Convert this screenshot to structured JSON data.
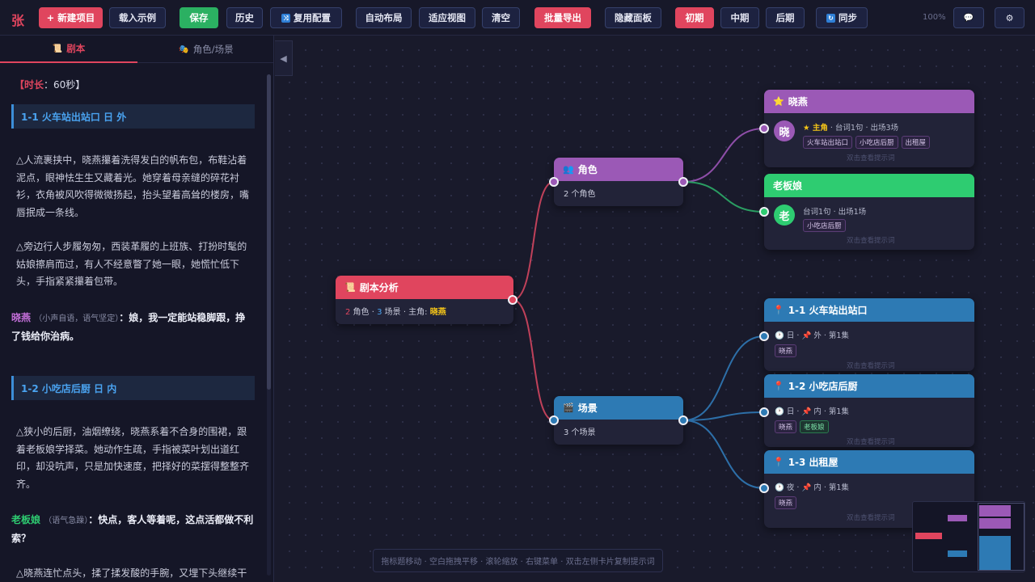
{
  "toolbar": {
    "logo": "张",
    "new_project": "+ 新建项目",
    "load_example": "载入示例",
    "save": "保存",
    "history": "历史",
    "reuse_config": "复用配置",
    "auto_layout": "自动布局",
    "fit_view": "适应视图",
    "clear": "清空",
    "batch_export": "批量导出",
    "hide_panel": "隐藏面板",
    "stage_early": "初期",
    "stage_mid": "中期",
    "stage_late": "后期",
    "sync": "同步",
    "zoom": "100%"
  },
  "left_panel": {
    "tabs": [
      {
        "label": "剧本",
        "icon": "scroll-icon"
      },
      {
        "label": "角色/场景",
        "icon": "mask-icon"
      }
    ],
    "duration_label": "【时长",
    "duration_value": "：60秒】",
    "scenes": [
      {
        "heading": "1-1 火车站出站口 日 外"
      },
      {
        "heading": "1-2 小吃店后厨 日 内"
      }
    ],
    "paragraphs": [
      "△人流裹挟中，晓燕攥着洗得发白的帆布包，布鞋沾着泥点，眼神怯生生又藏着光。她穿着母亲缝的碎花衬衫，衣角被风吹得微微扬起，抬头望着高耸的楼房，嘴唇抿成一条线。",
      "△旁边行人步履匆匆，西装革履的上班族、打扮时髦的姑娘擦肩而过，有人不经意瞥了她一眼，她慌忙低下头，手指紧紧攥着包带。",
      "△狭小的后厨，油烟缭绕，晓燕系着不合身的围裙，跟着老板娘学择菜。她动作生疏，手指被菜叶划出道红印，却没吭声，只是加快速度，把择好的菜摆得整整齐齐。",
      "△晓燕连忙点头，揉了揉发酸的手腕，又埋下头继续干"
    ],
    "dialogues": [
      {
        "speaker": "晓燕",
        "note": "（小声自语，语气坚定）",
        "line": "：娘，我一定能站稳脚跟，挣了钱给你治病。",
        "color": "#c36fd9"
      },
      {
        "speaker": "老板娘",
        "note": "（语气急躁）",
        "line": "：快点，客人等着呢，这点活都做不利索？",
        "color": "#2ecc71"
      }
    ]
  },
  "nodes": {
    "root": {
      "title": "剧本分析",
      "count_roles": "2",
      "roles_label": " 角色 · ",
      "count_scenes": "3",
      "scenes_label": " 场景 · 主角: ",
      "lead": "晓燕"
    },
    "roles": {
      "title": "角色",
      "summary": "2 个角色"
    },
    "scenes": {
      "title": "场景",
      "summary": "3 个场景"
    },
    "char1": {
      "title": "晓燕",
      "avatar": "晓",
      "badge": "★ 主角",
      "stats": " · 台词1句 · 出场3场",
      "tags": [
        "火车站出站口",
        "小吃店后厨",
        "出租屋"
      ],
      "hint": "双击查看提示词"
    },
    "char2": {
      "title": "老板娘",
      "avatar": "老",
      "stats": "台词1句 · 出场1场",
      "tags": [
        "小吃店后厨"
      ],
      "hint": "双击查看提示词"
    },
    "scene1": {
      "title": "1-1 火车站出站口",
      "time": "日",
      "place": "外 · 第1集",
      "tags": [
        "晓燕"
      ],
      "hint": "双击查看提示词"
    },
    "scene2": {
      "title": "1-2 小吃店后厨",
      "time": "日",
      "place": "内 · 第1集",
      "tags": [
        "晓燕",
        "老板娘"
      ],
      "hint": "双击查看提示词"
    },
    "scene3": {
      "title": "1-3 出租屋",
      "time": "夜",
      "place": "内 · 第1集",
      "tags": [
        "晓燕"
      ],
      "hint": "双击查看提示词"
    }
  },
  "bottom_hint": "拖标题移动 · 空白拖拽平移 · 滚轮缩放 · 右键菜单 · 双击左侧卡片复制提示词",
  "colors": {
    "accent": "#e0455e",
    "save": "#2bb062",
    "role": "#9b59b6",
    "scene": "#2d7ab4",
    "char2": "#2ecc71"
  }
}
